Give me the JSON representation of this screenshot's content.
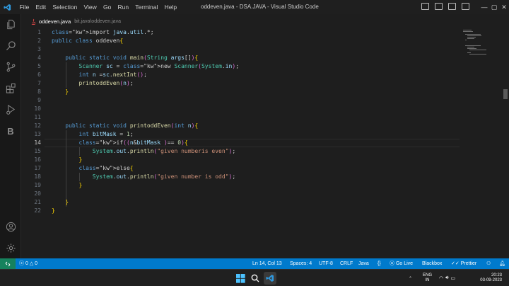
{
  "window": {
    "title": "oddeven.java - DSA.JAVA - Visual Studio Code",
    "menu": [
      "File",
      "Edit",
      "Selection",
      "View",
      "Go",
      "Run",
      "Terminal",
      "Help"
    ]
  },
  "activity_bar": {
    "items": [
      "explorer-icon",
      "search-icon",
      "source-control-icon",
      "extensions-icon",
      "run-debug-icon",
      "blackbox-icon"
    ],
    "bottom": [
      "account-icon",
      "manage-gear-icon"
    ],
    "blackbox_letter": "B"
  },
  "tab": {
    "name": "oddeven.java",
    "path": "bit.java\\oddeven.java"
  },
  "editor": {
    "current_line": 14,
    "lines": [
      {
        "n": "1",
        "text": "import java.util.*;"
      },
      {
        "n": "2",
        "text": "public class oddeven{"
      },
      {
        "n": "3",
        "text": ""
      },
      {
        "n": "4",
        "text": "    public static void main(String args[]){"
      },
      {
        "n": "5",
        "text": "        Scanner sc = new Scanner(System.in);"
      },
      {
        "n": "6",
        "text": "        int n =sc.nextInt();"
      },
      {
        "n": "7",
        "text": "        printoddEven(n);"
      },
      {
        "n": "8",
        "text": "    }"
      },
      {
        "n": "9",
        "text": ""
      },
      {
        "n": "10",
        "text": ""
      },
      {
        "n": "11",
        "text": ""
      },
      {
        "n": "12",
        "text": "    public static void printoddEven(int n){"
      },
      {
        "n": "13",
        "text": "        int bitMask = 1;"
      },
      {
        "n": "14",
        "text": "        if((n&bitMask )== 0){"
      },
      {
        "n": "15",
        "text": "            System.out.println(\"given numberis even\");"
      },
      {
        "n": "16",
        "text": "        }"
      },
      {
        "n": "17",
        "text": "        else{"
      },
      {
        "n": "18",
        "text": "            System.out.println(\"given number is odd\");"
      },
      {
        "n": "19",
        "text": "        }"
      },
      {
        "n": "20",
        "text": ""
      },
      {
        "n": "21",
        "text": "    }"
      },
      {
        "n": "22",
        "text": "}"
      }
    ]
  },
  "status_bar": {
    "errors": "0",
    "warnings": "0",
    "position": "Ln 14, Col 13",
    "spaces": "Spaces: 4",
    "encoding": "UTF-8",
    "eol": "CRLF",
    "language": "Java",
    "go_live": "Go Live",
    "blackbox": "Blackbox",
    "prettier": "Prettier"
  },
  "taskbar": {
    "lang_top": "ENG",
    "lang_bottom": "IN",
    "time": "20:23",
    "date": "03-09-2023"
  },
  "colors": {
    "status_bar": "#007acc",
    "remote": "#16825d",
    "editor_bg": "#1e1e1e"
  }
}
